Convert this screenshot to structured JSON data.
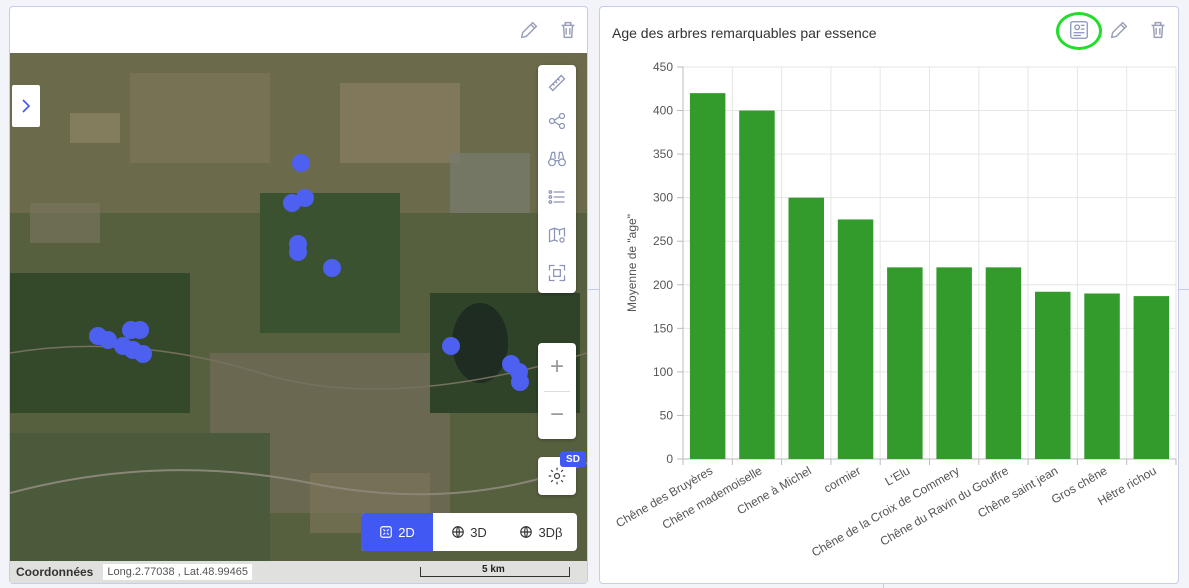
{
  "map_panel": {
    "coord_label": "Coordonnées",
    "coord_value": "Long.2.77038 , Lat.48.99465",
    "scale_label": "5 km",
    "sd_badge": "SD",
    "view_buttons": [
      "2D",
      "3D",
      "3Dβ"
    ],
    "active_view": "2D",
    "tools": [
      "ruler-icon",
      "share-icon",
      "binoculars-icon",
      "list-icon",
      "map-settings-icon",
      "fullscreen-icon"
    ],
    "zoom_in": "+",
    "zoom_out": "−"
  },
  "chart_panel": {
    "title": "Age des arbres remarquables par essence"
  },
  "colors": {
    "accent": "#4258f2",
    "bar": "#339b2b",
    "highlight": "#22dd2a",
    "marker": "#4d60f0"
  },
  "chart_data": {
    "type": "bar",
    "title": "Age des arbres remarquables par essence",
    "xlabel": "",
    "ylabel": "Moyenne de \"age\"",
    "ylim": [
      0,
      450
    ],
    "yticks": [
      0,
      50,
      100,
      150,
      200,
      250,
      300,
      350,
      400,
      450
    ],
    "grid": true,
    "categories": [
      "Chêne des Bruyères",
      "Chêne mademoiselle",
      "Chene à Michel",
      "cormier",
      "L'Elu",
      "Chêne de la Croix de Commery",
      "Chêne du Ravin du Gouffre",
      "Chêne saint jean",
      "Gros chêne",
      "Hêtre richou"
    ],
    "values": [
      420,
      400,
      300,
      275,
      220,
      220,
      220,
      192,
      190,
      187
    ]
  }
}
